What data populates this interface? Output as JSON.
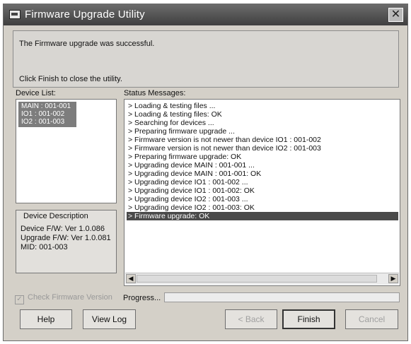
{
  "window": {
    "title": "Firmware Upgrade Utility",
    "close_glyph": "✕"
  },
  "messages": {
    "line1": "The Firmware upgrade was successful.",
    "line2": "Click Finish to close the utility."
  },
  "device_list": {
    "label": "Device List:",
    "items": [
      "MAIN : 001-001",
      "IO1 : 001-002",
      "IO2 : 001-003"
    ]
  },
  "device_description": {
    "label": "Device Description",
    "device_fw": "Device F/W: Ver 1.0.086",
    "upgrade_fw": "Upgrade F/W: Ver 1.0.081",
    "mid": "MID: 001-003"
  },
  "status": {
    "label": "Status Messages:",
    "lines": [
      "> Loading & testing files ...",
      "> Loading & testing files: OK",
      "> Searching for devices ...",
      "> Preparing firmware upgrade ...",
      "> Firmware version is not newer than device IO1 : 001-002",
      "> Firmware version is not newer than device IO2 : 001-003",
      "> Preparing firmware upgrade: OK",
      "> Upgrading device MAIN : 001-001 ...",
      "> Upgrading device MAIN : 001-001: OK",
      "> Upgrading device IO1 : 001-002 ...",
      "> Upgrading device IO1 : 001-002: OK",
      "> Upgrading device IO2 : 001-003 ...",
      "> Upgrading device IO2 : 001-003: OK",
      "> Firmware upgrade: OK"
    ],
    "selected_index": 13
  },
  "check_firmware": {
    "label": "Check Firmware Version",
    "checked": true
  },
  "progress": {
    "label": "Progress...",
    "value": 0
  },
  "buttons": {
    "help": "Help",
    "view_log": "View Log",
    "back": "< Back",
    "finish": "Finish",
    "cancel": "Cancel"
  },
  "icons": {
    "close": "close-icon",
    "app": "app-icon",
    "check": "check-icon",
    "scroll_left": "arrow-left-icon",
    "scroll_right": "arrow-right-icon"
  }
}
